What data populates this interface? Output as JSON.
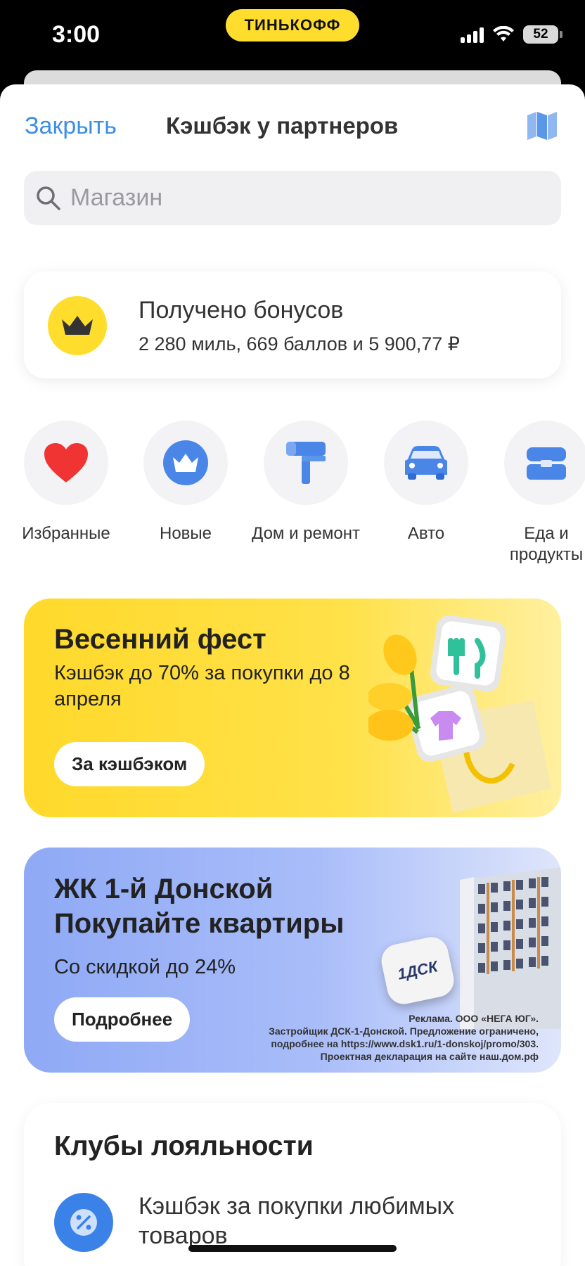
{
  "status_bar": {
    "time": "3:00",
    "brand": "ТИНЬКОФФ",
    "battery": "52"
  },
  "nav": {
    "close_label": "Закрыть",
    "title": "Кэшбэк у партнеров"
  },
  "search": {
    "placeholder": "Магазин"
  },
  "bonus": {
    "title": "Получено бонусов",
    "subtitle": "2 280 миль, 669 баллов и 5 900,77 ₽"
  },
  "categories": [
    {
      "label": "Избранные",
      "icon": "heart-icon"
    },
    {
      "label": "Новые",
      "icon": "crown-icon"
    },
    {
      "label": "Дом и ремонт",
      "icon": "paint-roller-icon"
    },
    {
      "label": "Авто",
      "icon": "car-icon"
    },
    {
      "label": "Еда и продукты",
      "icon": "food-box-icon"
    }
  ],
  "promo_spring": {
    "title": "Весенний фест",
    "text": "Кэшбэк до 70% за покупки до 8 апреля",
    "button": "За кэшбэком"
  },
  "promo_donskoy": {
    "title_line1": "ЖК 1-й Донской",
    "title_line2": "Покупайте квартиры",
    "text": "Со скидкой до 24%",
    "button": "Подробнее",
    "logo": "1ДСК",
    "ad_line1": "Реклама. ООО «НЕГА ЮГ».",
    "ad_line2": "Застройщик ДСК-1-Донской. Предложение ограничено,",
    "ad_line3": "подробнее на https://www.dsk1.ru/1-donskoj/promo/303.",
    "ad_line4": "Проектная декларация на сайте наш.дом.рф"
  },
  "clubs": {
    "title": "Клубы лояльности",
    "item_text": "Кэшбэк за покупки любимых товаров"
  },
  "colors": {
    "accent_yellow": "#ffdd2d",
    "link_blue": "#3b8fe8",
    "icon_blue": "#3b82e8"
  }
}
